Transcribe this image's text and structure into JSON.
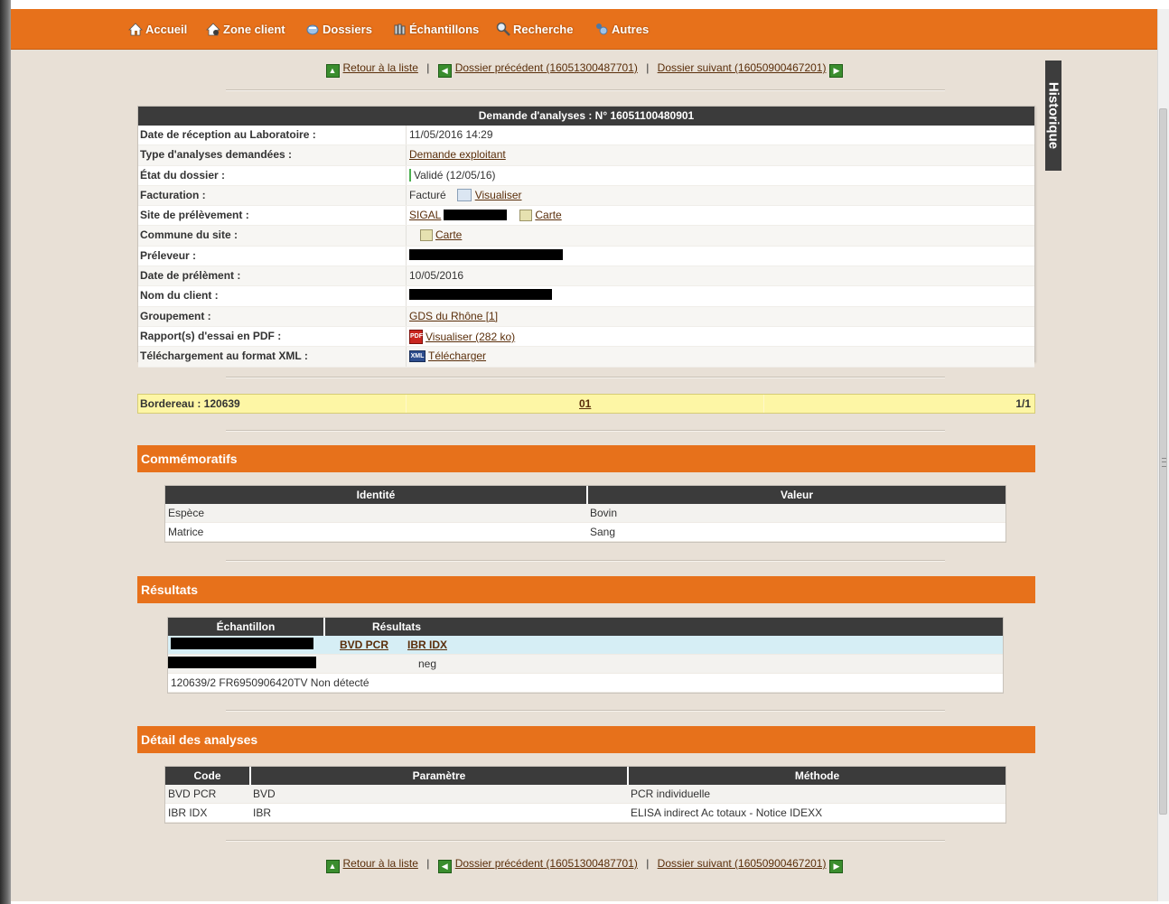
{
  "nav": {
    "items": [
      {
        "label": "Accueil",
        "icon": "home-icon"
      },
      {
        "label": "Zone client",
        "icon": "client-zone-icon"
      },
      {
        "label": "Dossiers",
        "icon": "folder-icon"
      },
      {
        "label": "Échantillons",
        "icon": "samples-icon"
      },
      {
        "label": "Recherche",
        "icon": "search-icon"
      },
      {
        "label": "Autres",
        "icon": "others-icon"
      }
    ]
  },
  "links": {
    "back_to_list": "Retour à la liste",
    "previous": "Dossier précédent (16051300487701)",
    "next": "Dossier suivant (16050900467201)",
    "separator": "|"
  },
  "historique_label": "Historique",
  "request": {
    "title": "Demande d'analyses : N° 16051100480901",
    "rows": [
      {
        "label": "Date de réception au Laboratoire :",
        "value": "11/05/2016 14:29"
      },
      {
        "label": "Type d'analyses demandées :",
        "value": "Demande exploitant"
      },
      {
        "label": "État du dossier :",
        "value": "Validé (12/05/16)"
      },
      {
        "label": "Facturation :",
        "value": "Facturé",
        "link": "Visualiser"
      },
      {
        "label": "Site de prélèvement :",
        "value": "SIGAL",
        "link": "Carte"
      },
      {
        "label": "Commune du site :",
        "link": "Carte"
      },
      {
        "label": "Préleveur :"
      },
      {
        "label": "Date de prélèment :",
        "value": "10/05/2016"
      },
      {
        "label": "Nom du client :"
      },
      {
        "label": "Groupement :",
        "value": "GDS du Rhône [1]"
      },
      {
        "label": "Rapport(s) d'essai en PDF :",
        "link": "Visualiser (282 ko)"
      },
      {
        "label": "Téléchargement au format XML :",
        "link": "Télécharger"
      }
    ]
  },
  "bordereau": {
    "label": "Bordereau : 120639",
    "number": "01",
    "pages": "1/1"
  },
  "commemoratifs": {
    "title": "Commémoratifs",
    "headers": [
      "Identité",
      "Valeur"
    ],
    "rows": [
      [
        "Espèce",
        "Bovin"
      ],
      [
        "Matrice",
        "Sang"
      ]
    ]
  },
  "resultats": {
    "title": "Résultats",
    "headers": [
      "Échantillon",
      "Résultats"
    ],
    "analyses": [
      "BVD PCR",
      "IBR IDX"
    ],
    "value_row": [
      "neg"
    ],
    "footer": "120639/2 FR6950906420TV",
    "footer_status": "Non détecté"
  },
  "detail": {
    "title": "Détail des analyses",
    "headers": [
      "Code",
      "Paramètre",
      "Méthode"
    ],
    "rows": [
      [
        "BVD PCR",
        "BVD",
        "PCR individuelle"
      ],
      [
        "IBR IDX",
        "IBR",
        "ELISA indirect Ac totaux - Notice IDEXX"
      ]
    ]
  }
}
